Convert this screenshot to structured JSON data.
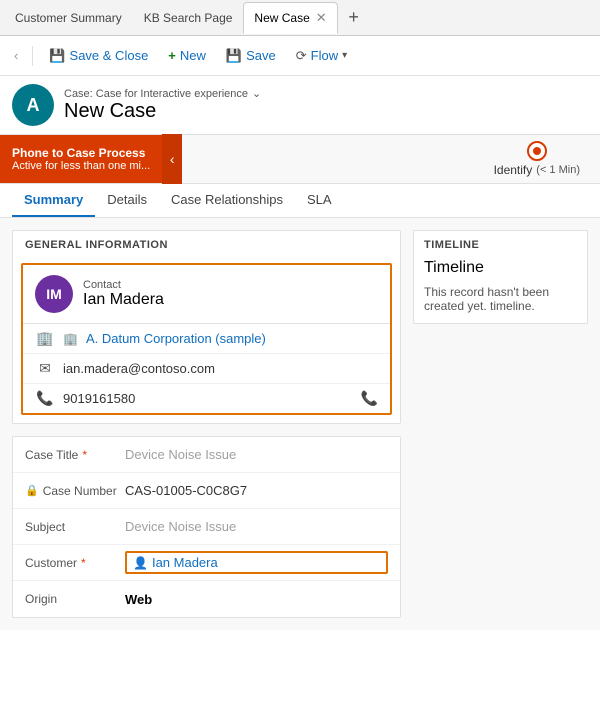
{
  "tabs": [
    {
      "id": "customer-summary",
      "label": "Customer Summary",
      "active": false
    },
    {
      "id": "kb-search-page",
      "label": "KB Search Page",
      "active": false
    },
    {
      "id": "new-case",
      "label": "New Case",
      "active": true
    }
  ],
  "toolbar": {
    "back_label": "‹",
    "save_close_label": "Save & Close",
    "new_label": "New",
    "save_label": "Save",
    "flow_label": "Flow",
    "flow_icon": "⟳"
  },
  "header": {
    "avatar_initials": "A",
    "breadcrumb": "Case: Case for Interactive experience",
    "title": "New Case"
  },
  "process_bar": {
    "phase_title": "Phone to Case Process",
    "phase_sub": "Active for less than one mi...",
    "step_label": "Identify",
    "step_time": "(< 1 Min)"
  },
  "nav_tabs": [
    {
      "id": "summary",
      "label": "Summary",
      "active": true
    },
    {
      "id": "details",
      "label": "Details",
      "active": false
    },
    {
      "id": "case-relationships",
      "label": "Case Relationships",
      "active": false
    },
    {
      "id": "sla",
      "label": "SLA",
      "active": false
    }
  ],
  "general_info": {
    "section_title": "GENERAL INFORMATION",
    "contact": {
      "avatar_initials": "IM",
      "label": "Contact",
      "name": "Ian Madera",
      "company_icon": "🏢",
      "company": "A. Datum Corporation (sample)",
      "email": "ian.madera@contoso.com",
      "phone": "9019161580"
    }
  },
  "form": {
    "fields": [
      {
        "id": "case-title",
        "label": "Case Title",
        "required": true,
        "value": "Device Noise Issue",
        "type": "text"
      },
      {
        "id": "case-number",
        "label": "Case Number",
        "required": false,
        "value": "CAS-01005-C0C8G7",
        "type": "text",
        "lock": true
      },
      {
        "id": "subject",
        "label": "Subject",
        "required": false,
        "value": "Device Noise Issue",
        "type": "placeholder"
      },
      {
        "id": "customer",
        "label": "Customer",
        "required": true,
        "value": "Ian Madera",
        "type": "customer"
      },
      {
        "id": "origin",
        "label": "Origin",
        "required": false,
        "value": "Web",
        "type": "bold"
      }
    ]
  },
  "timeline": {
    "section_title": "TIMELINE",
    "title": "Timeline",
    "empty_text": "This record hasn't been created yet. timeline."
  }
}
